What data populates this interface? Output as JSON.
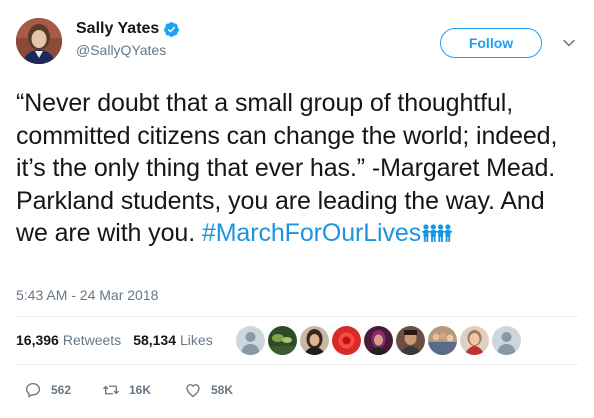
{
  "user": {
    "name": "Sally Yates",
    "handle": "@SallyQYates",
    "verified": true
  },
  "follow_label": "Follow",
  "tweet": {
    "text": "“Never doubt that a small group of thoughtful, committed citizens can change the world; indeed, it’s the only thing that ever has.” -Margaret Mead. Parkland students, you are leading the way. And we are with you. ",
    "hashtag": "#MarchForOurLives",
    "emoji": "people-holding-hands-icon"
  },
  "timestamp": "5:43 AM - 24 Mar 2018",
  "stats": {
    "retweets_count": "16,396",
    "retweets_label": "Retweets",
    "likes_count": "58,134",
    "likes_label": "Likes"
  },
  "actions": {
    "reply_count": "562",
    "retweet_count": "16K",
    "like_count": "58K"
  },
  "colors": {
    "accent": "#1da1f2",
    "hashtag": "#1b95e0",
    "muted": "#657786",
    "text": "#14171a",
    "divider": "#e6ecf0"
  }
}
